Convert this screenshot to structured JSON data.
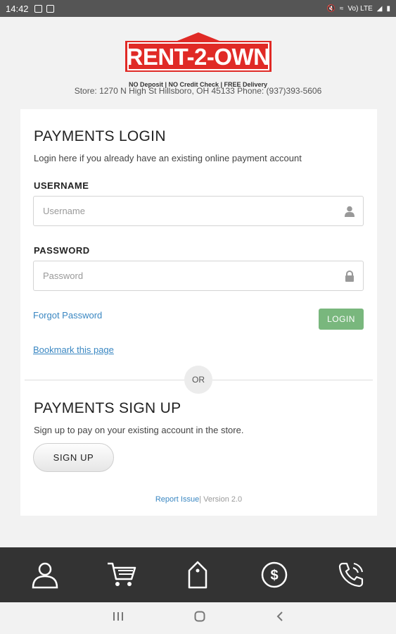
{
  "status_bar": {
    "time": "14:42",
    "network_label": "Vo) LTE"
  },
  "header": {
    "brand": "RENT-2-OWN",
    "tagline": "NO Deposit | NO Credit Check | FREE Delivery",
    "store_info": "Store: 1270 N High St Hillsboro, OH 45133 Phone: (937)393-5606",
    "brand_color": "#e02a26"
  },
  "login": {
    "title": "PAYMENTS LOGIN",
    "subtitle": "Login here if you already have an existing online payment account",
    "username_label": "USERNAME",
    "username_placeholder": "Username",
    "password_label": "PASSWORD",
    "password_placeholder": "Password",
    "forgot_password": "Forgot Password",
    "login_button": "LOGIN",
    "bookmark_link": "Bookmark this page"
  },
  "divider": {
    "or_label": "OR"
  },
  "signup": {
    "title": "PAYMENTS SIGN UP",
    "subtitle": "Sign up to pay on your existing account in the store.",
    "button": "SIGN UP"
  },
  "footer": {
    "report_issue": "Report Issue",
    "version": "| Version 2.0"
  },
  "bottom_nav": {
    "items": [
      {
        "icon": "user-icon"
      },
      {
        "icon": "cart-icon"
      },
      {
        "icon": "tag-icon"
      },
      {
        "icon": "dollar-icon"
      },
      {
        "icon": "phone-icon"
      }
    ]
  },
  "colors": {
    "accent_link": "#3a87c2",
    "login_button": "#79b77d",
    "nav_background": "#333333"
  }
}
